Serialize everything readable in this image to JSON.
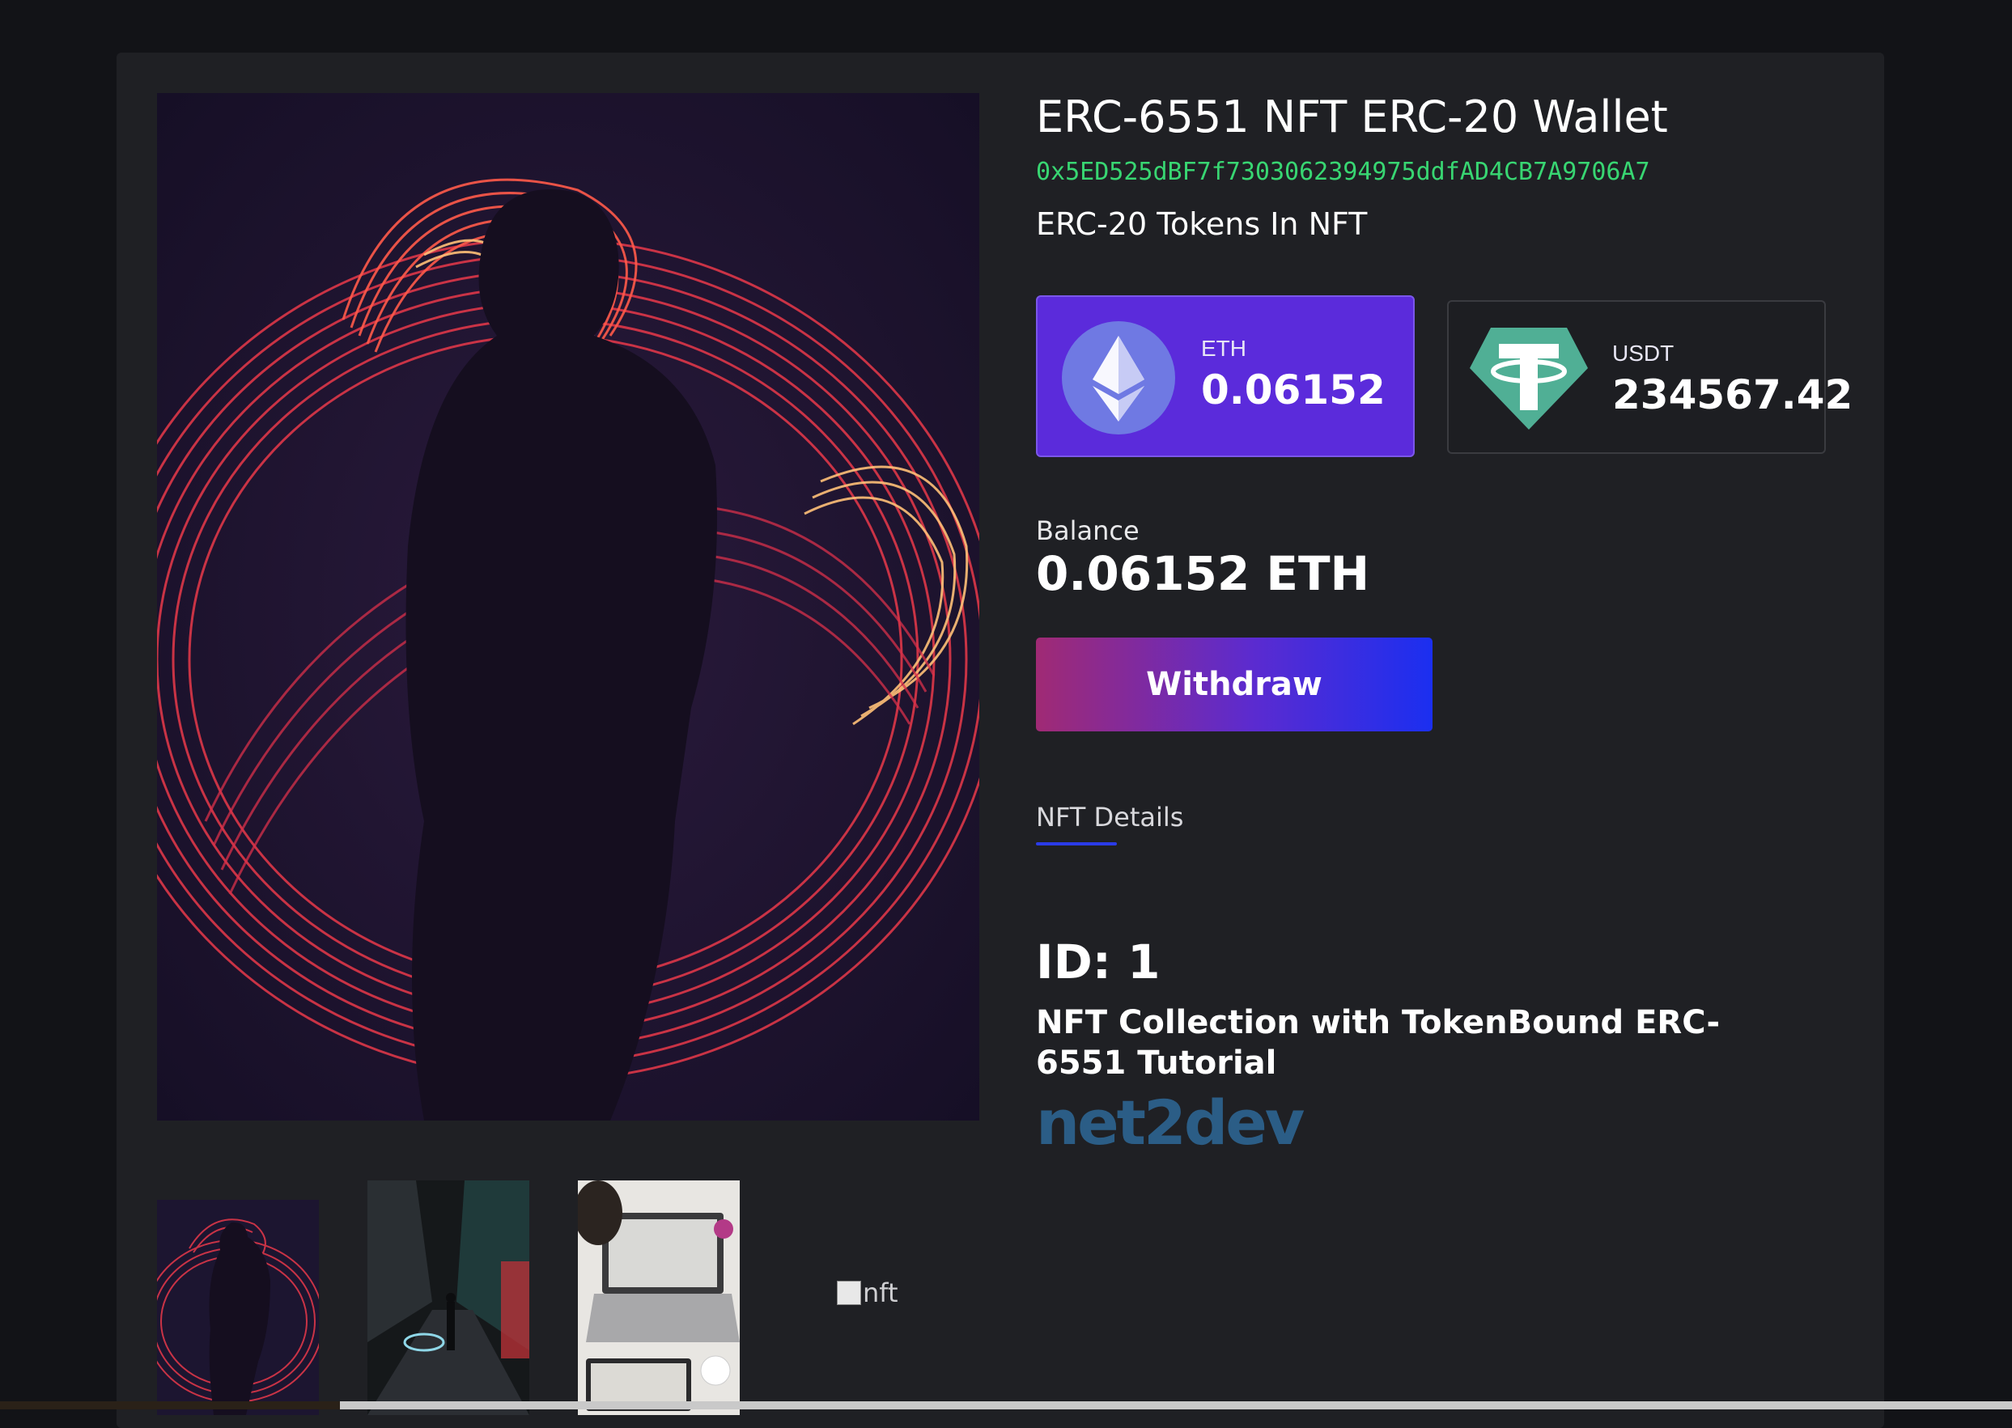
{
  "wallet": {
    "title": "ERC-6551 NFT ERC-20 Wallet",
    "address": "0x5ED525dBF7f7303062394975ddfAD4CB7A9706A7",
    "tokens_heading": "ERC-20 Tokens In NFT"
  },
  "tokens": [
    {
      "symbol": "ETH",
      "amount": "0.06152",
      "icon": "ethereum-icon",
      "color": "#5b2bdb"
    },
    {
      "symbol": "USDT",
      "amount": "234567.42",
      "icon": "tether-icon",
      "color": "#50af95"
    }
  ],
  "balance": {
    "label": "Balance",
    "value": "0.06152 ETH"
  },
  "actions": {
    "withdraw_label": "Withdraw"
  },
  "details": {
    "tab_label": "NFT Details",
    "id_text": "ID: 1",
    "description": "NFT Collection with TokenBound ERC-6551 Tutorial",
    "brand": "net2dev"
  },
  "gallery": {
    "broken_alt": "nft"
  },
  "colors": {
    "background": "#121317",
    "panel": "#1f2024",
    "address_green": "#38d672",
    "eth_card": "#5b2bdb",
    "accent_blue": "#2a3be8",
    "brand_blue": "#2b5d86"
  }
}
